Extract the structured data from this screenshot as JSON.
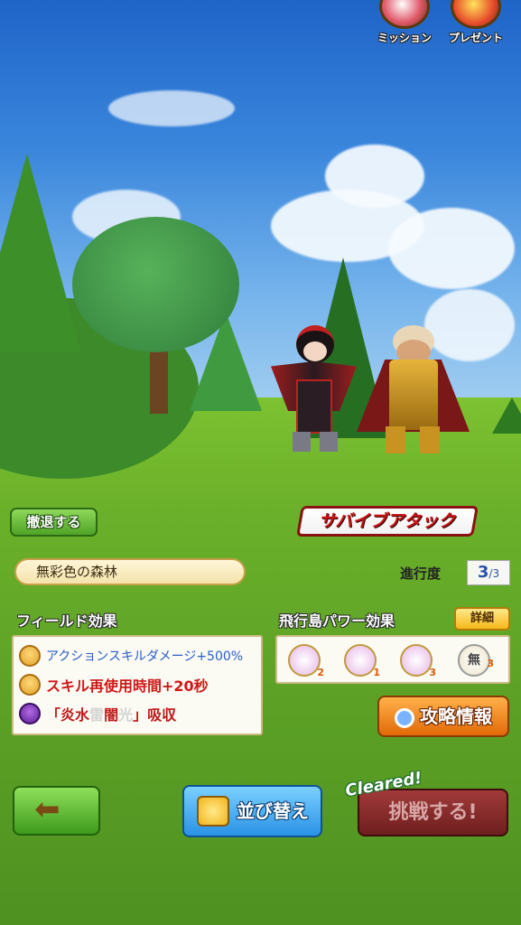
{
  "top_menu": {
    "mission_label": "ミッション",
    "present_label": "プレゼント"
  },
  "retreat_label": "撤退する",
  "survive_attack_label": "サバイブアタック",
  "stage": {
    "name": "無彩色の森林",
    "progress_label": "進行度",
    "progress_current": "3",
    "progress_total": "/3"
  },
  "field_effects": {
    "title": "フィールド効果",
    "items": [
      {
        "icon": "party-icon",
        "text": "アクションスキルダメージ+500%",
        "color": "#2a5fc8"
      },
      {
        "icon": "party-icon",
        "text": "スキル再使用時間+20秒",
        "color": "#d01818"
      },
      {
        "icon": "demon-icon",
        "text_parts": [
          "「",
          "炎",
          "水",
          "雷",
          "闇",
          "光",
          "」吸収"
        ],
        "part_colors": [
          "#c01818",
          "#c01818",
          "#c01818",
          "#d8d8d8",
          "#c01818",
          "#d8d8d8",
          "#c01818"
        ]
      }
    ]
  },
  "flying_island": {
    "title": "飛行島パワー効果",
    "detail_label": "詳細",
    "items": [
      {
        "icon": "sword-ring-icon",
        "level": "2",
        "color": "#f0c7e8"
      },
      {
        "icon": "sword-ring-icon",
        "level": "1",
        "color": "#f0c7e8"
      },
      {
        "icon": "sword-ring-icon",
        "level": "3",
        "color": "#f0c7e8"
      },
      {
        "icon": "mu-ring-icon",
        "glyph": "無",
        "level": "3",
        "color": "#f4f0e2"
      }
    ]
  },
  "strategy_label": "攻略情報",
  "bottom": {
    "back_arrow": "⬅",
    "sort_label": "並び替え",
    "cleared_label": "Cleared!",
    "challenge_label": "挑戦する!"
  }
}
